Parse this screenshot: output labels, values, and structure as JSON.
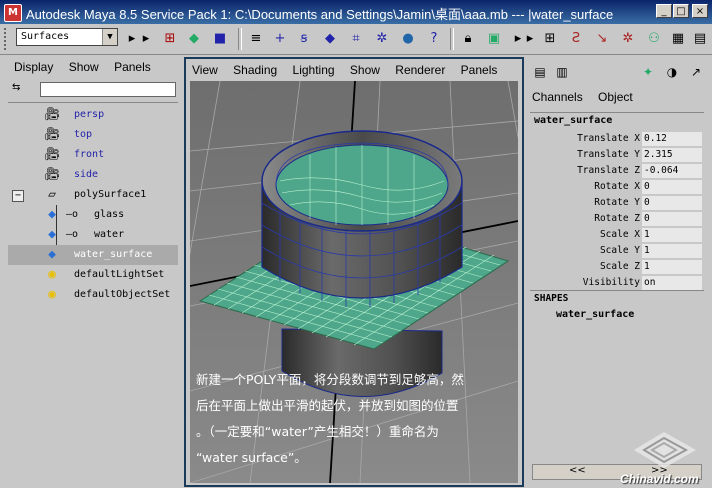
{
  "window": {
    "title": "Autodesk Maya 8.5 Service Pack 1: C:\\Documents and Settings\\Jamin\\桌面\\aaa.mb   ---   |water_surface",
    "min": "_",
    "max": "□",
    "close": "×"
  },
  "toolbar": {
    "menu_set": "Surfaces"
  },
  "outliner": {
    "menu": [
      "Display",
      "Show",
      "Panels"
    ],
    "items": [
      {
        "label": "persp",
        "icon": "camera-icon",
        "indent": 0
      },
      {
        "label": "top",
        "icon": "camera-icon",
        "indent": 0
      },
      {
        "label": "front",
        "icon": "camera-icon",
        "indent": 0
      },
      {
        "label": "side",
        "icon": "camera-icon",
        "indent": 0
      },
      {
        "label": "polySurface1",
        "icon": "transform-icon",
        "indent": 0
      },
      {
        "label": "glass",
        "icon": "mesh-icon",
        "indent": 1
      },
      {
        "label": "water",
        "icon": "mesh-icon",
        "indent": 1
      },
      {
        "label": "water_surface",
        "icon": "mesh-icon",
        "indent": 0
      },
      {
        "label": "defaultLightSet",
        "icon": "set-icon",
        "indent": 0
      },
      {
        "label": "defaultObjectSet",
        "icon": "set-icon",
        "indent": 0
      }
    ],
    "expand_sign": "−"
  },
  "viewport": {
    "menu": [
      "View",
      "Shading",
      "Lighting",
      "Show",
      "Renderer",
      "Panels"
    ],
    "caption": [
      "新建一个POLY平面，将分段数调节到足够高，然",
      "后在平面上做出平滑的起伏，并放到如图的位置",
      "。（一定要和“water”产生相交！）重命名为",
      "“water surface”。"
    ]
  },
  "channel_box": {
    "menu": [
      "Channels",
      "Object"
    ],
    "object_name": "water_surface",
    "attributes": [
      {
        "name": "Translate X",
        "value": "0.12"
      },
      {
        "name": "Translate Y",
        "value": "2.315"
      },
      {
        "name": "Translate Z",
        "value": "-0.064"
      },
      {
        "name": "Rotate X",
        "value": "0"
      },
      {
        "name": "Rotate Y",
        "value": "0"
      },
      {
        "name": "Rotate Z",
        "value": "0"
      },
      {
        "name": "Scale X",
        "value": "1"
      },
      {
        "name": "Scale Y",
        "value": "1"
      },
      {
        "name": "Scale Z",
        "value": "1"
      },
      {
        "name": "Visibility",
        "value": "on"
      }
    ],
    "shapes_header": "SHAPES",
    "shape_name": "water_surface",
    "nav_left": "<<",
    "nav_right": ">>"
  },
  "watermark": {
    "text": "Chinavid.com"
  }
}
